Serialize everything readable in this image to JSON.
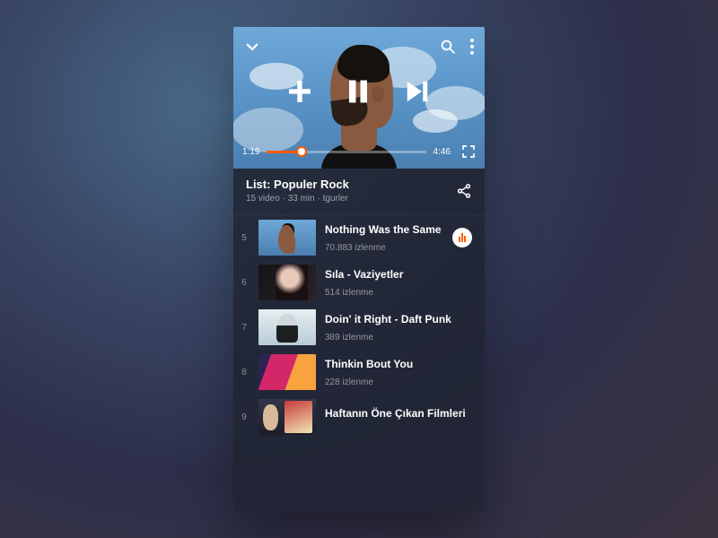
{
  "player": {
    "time_elapsed": "1:19",
    "time_total": "4:46",
    "progress_pct": 22
  },
  "list_header": {
    "title": "List: Populer Rock",
    "meta_videos": "15 video",
    "meta_duration": "33 min",
    "meta_author": "tgurler"
  },
  "tracks": [
    {
      "index": "5",
      "title": "Nothing Was the Same",
      "views": "70.883 izlenme",
      "now_playing": true
    },
    {
      "index": "6",
      "title": "Sıla - Vaziyetler",
      "views": "514 izlenme",
      "now_playing": false
    },
    {
      "index": "7",
      "title": "Doin' it Right - Daft Punk",
      "views": "389 izlenme",
      "now_playing": false
    },
    {
      "index": "8",
      "title": "Thinkin Bout You",
      "views": "228 izlenme",
      "now_playing": false
    },
    {
      "index": "9",
      "title": "Haftanın Öne Çıkan Filmleri",
      "views": "",
      "now_playing": false
    }
  ],
  "colors": {
    "accent": "#ff5a00"
  }
}
